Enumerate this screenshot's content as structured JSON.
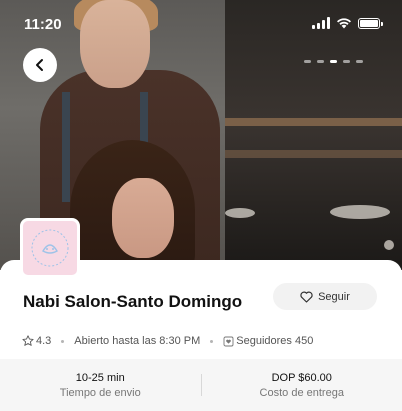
{
  "status_bar": {
    "time": "11:20"
  },
  "carousel": {
    "count": 5,
    "active_index": 2
  },
  "store": {
    "name": "Nabi Salon-Santo Domingo",
    "follow_label": "Seguir",
    "rating": "4.3",
    "hours": "Abierto hasta las 8:30 PM",
    "followers": "Seguidores 450"
  },
  "delivery": {
    "time_value": "10-25 min",
    "time_label": "Tiempo de envio",
    "cost_value": "DOP $60.00",
    "cost_label": "Costo de entrega"
  },
  "colors": {
    "logo_bg": "#f7d9e4",
    "logo_art": "#9ec3e8",
    "card_bg": "#ffffff",
    "strip_bg": "#f6f6f6"
  }
}
